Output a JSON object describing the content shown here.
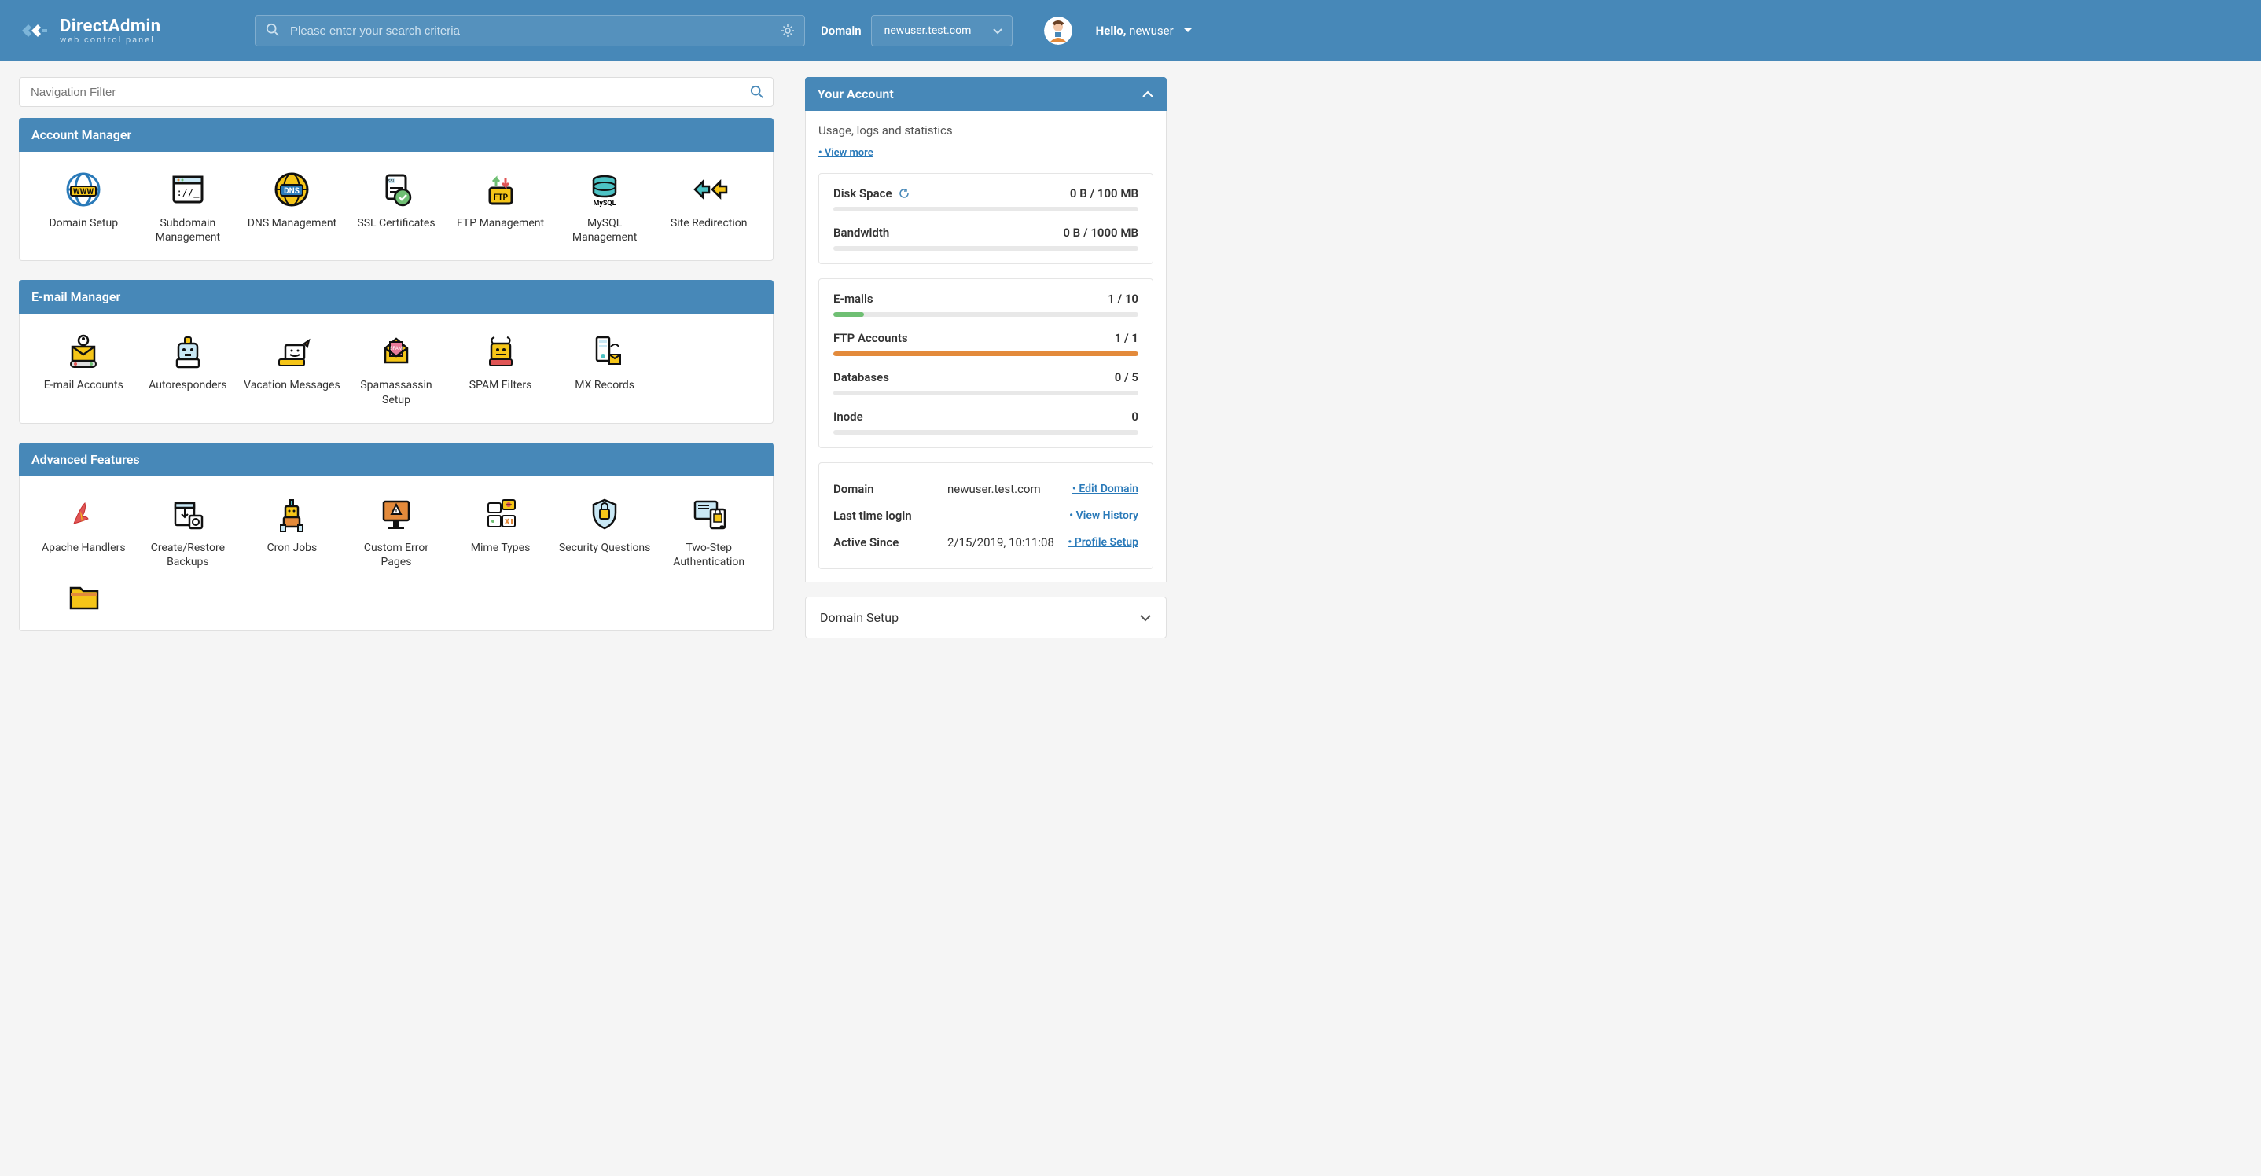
{
  "header": {
    "logo_title": "DirectAdmin",
    "logo_sub": "web control panel",
    "search_placeholder": "Please enter your search criteria",
    "domain_label": "Domain",
    "domain_value": "newuser.test.com",
    "hello_prefix": "Hello,",
    "hello_user": "newuser"
  },
  "navfilter_placeholder": "Navigation Filter",
  "sections": {
    "account": {
      "title": "Account Manager",
      "items": [
        {
          "label": "Domain Setup",
          "icon": "www"
        },
        {
          "label": "Subdomain Management",
          "icon": "browser"
        },
        {
          "label": "DNS Management",
          "icon": "dns"
        },
        {
          "label": "SSL Certificates",
          "icon": "ssl"
        },
        {
          "label": "FTP Management",
          "icon": "ftp"
        },
        {
          "label": "MySQL Management",
          "icon": "mysql"
        },
        {
          "label": "Site Redirection",
          "icon": "redirect"
        }
      ]
    },
    "email": {
      "title": "E-mail Manager",
      "items": [
        {
          "label": "E-mail Accounts",
          "icon": "email-acc"
        },
        {
          "label": "Autoresponders",
          "icon": "autores"
        },
        {
          "label": "Vacation Messages",
          "icon": "vacation"
        },
        {
          "label": "Spamassassin Setup",
          "icon": "spamass"
        },
        {
          "label": "SPAM Filters",
          "icon": "spamfilter"
        },
        {
          "label": "MX Records",
          "icon": "mx"
        }
      ]
    },
    "advanced": {
      "title": "Advanced Features",
      "items": [
        {
          "label": "Apache Handlers",
          "icon": "apache"
        },
        {
          "label": "Create/Restore Backups",
          "icon": "backup"
        },
        {
          "label": "Cron Jobs",
          "icon": "cron"
        },
        {
          "label": "Custom Error Pages",
          "icon": "errorpage"
        },
        {
          "label": "Mime Types",
          "icon": "mime"
        },
        {
          "label": "Security Questions",
          "icon": "security"
        },
        {
          "label": "Two-Step Authentication",
          "icon": "twostep"
        }
      ]
    }
  },
  "side": {
    "title": "Your Account",
    "sub": "Usage, logs and statistics",
    "view_more": "• View more",
    "stats1": [
      {
        "name": "Disk Space",
        "value": "0 B / 100 MB",
        "pct": 0,
        "refresh": true
      },
      {
        "name": "Bandwidth",
        "value": "0 B / 1000 MB",
        "pct": 0
      }
    ],
    "stats2": [
      {
        "name": "E-mails",
        "value": "1 / 10",
        "pct": 10,
        "color": "green"
      },
      {
        "name": "FTP Accounts",
        "value": "1 / 1",
        "pct": 100,
        "color": "orange"
      },
      {
        "name": "Databases",
        "value": "0 / 5",
        "pct": 0
      },
      {
        "name": "Inode",
        "value": "0",
        "pct": 0
      }
    ],
    "info": [
      {
        "label": "Domain",
        "value": "newuser.test.com",
        "link": "• Edit Domain"
      },
      {
        "label": "Last time login",
        "value": "",
        "link": "• View History"
      },
      {
        "label": "Active Since",
        "value": "2/15/2019, 10:11:08",
        "link": "• Profile Setup"
      }
    ],
    "collapsed": "Domain Setup"
  }
}
